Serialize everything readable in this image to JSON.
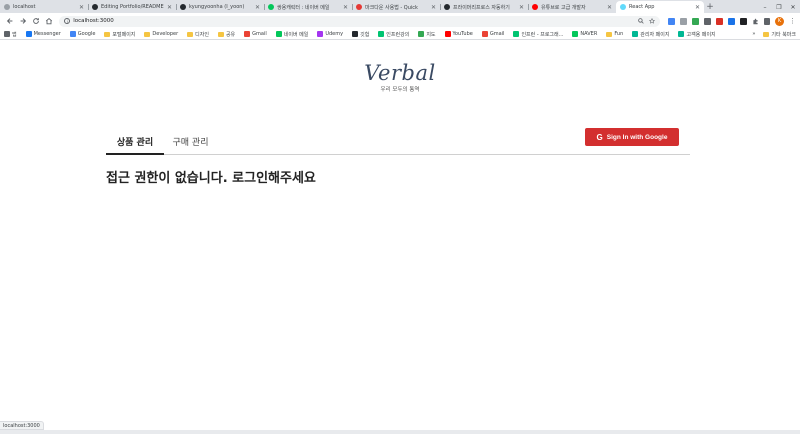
{
  "browser": {
    "tabs": [
      {
        "title": "localhost",
        "icon_color": "#9aa0a6",
        "active": false
      },
      {
        "title": "Editing Portfolio/README",
        "icon_color": "#24292e",
        "active": false
      },
      {
        "title": "kyungyoonha (I_yoon)",
        "icon_color": "#24292e",
        "active": false
      },
      {
        "title": "쌍용캐릭터 : 네이버 메일",
        "icon_color": "#03c75a",
        "active": false
      },
      {
        "title": "마크다운 사용법 - Quick",
        "icon_color": "#e53935",
        "active": false
      },
      {
        "title": "프라이머리프로스 자동하기",
        "icon_color": "#24292e",
        "active": false
      },
      {
        "title": "유튜브로 고급 개발자",
        "icon_color": "#ff0000",
        "active": false
      },
      {
        "title": "React App",
        "icon_color": "#61dafb",
        "active": true
      }
    ],
    "new_tab_label": "+",
    "window_controls": [
      "–",
      "❐",
      "✕"
    ],
    "url": "localhost:3000",
    "bookmarks": [
      {
        "label": "앱",
        "icon": "apps-icon",
        "color": "#5f6368"
      },
      {
        "label": "Messenger",
        "icon": "messenger-icon",
        "color": "#1877f2"
      },
      {
        "label": "Google",
        "icon": "google-icon",
        "color": "#4285f4"
      },
      {
        "label": "포털페이지",
        "icon": "folder-icon",
        "color": "#f5c542"
      },
      {
        "label": "Developer",
        "icon": "folder-icon",
        "color": "#f5c542"
      },
      {
        "label": "디자인",
        "icon": "folder-icon",
        "color": "#f5c542"
      },
      {
        "label": "공유",
        "icon": "folder-icon",
        "color": "#f5c542"
      },
      {
        "label": "Gmail",
        "icon": "gmail-icon",
        "color": "#ea4335"
      },
      {
        "label": "네이버 메일",
        "icon": "naver-icon",
        "color": "#03c75a"
      },
      {
        "label": "Udemy",
        "icon": "udemy-icon",
        "color": "#a435f0"
      },
      {
        "label": "깃헙",
        "icon": "github-icon",
        "color": "#24292e"
      },
      {
        "label": "인프런강의",
        "icon": "inflearn-icon",
        "color": "#00c471"
      },
      {
        "label": "지도",
        "icon": "maps-icon",
        "color": "#34a853"
      },
      {
        "label": "YouTube",
        "icon": "youtube-icon",
        "color": "#ff0000"
      },
      {
        "label": "Gmail",
        "icon": "gmail-icon",
        "color": "#ea4335"
      },
      {
        "label": "인프런 - 프로그래...",
        "icon": "inflearn-icon",
        "color": "#00c471"
      },
      {
        "label": "NAVER",
        "icon": "naver-icon",
        "color": "#03c75a"
      },
      {
        "label": "Fun",
        "icon": "folder-icon",
        "color": "#f5c542"
      },
      {
        "label": "관리자 페이지",
        "icon": "admin-icon",
        "color": "#00b894"
      },
      {
        "label": "고객용 페이지",
        "icon": "customer-icon",
        "color": "#00b894"
      }
    ],
    "bookmarks_overflow": "»",
    "other_bookmarks": "기타 북마크",
    "profile_initial": "K",
    "status_url": "localhost:3000"
  },
  "app": {
    "logo": "Verbal",
    "tagline": "우리 모두의 통역",
    "nav_tabs": [
      {
        "label": "상품 관리",
        "active": true
      },
      {
        "label": "구매 관리",
        "active": false
      }
    ],
    "signin_button": "Sign In with Google",
    "signin_icon": "G",
    "access_message": "접근 권한이 없습니다. 로그인해주세요",
    "colors": {
      "signin_bg": "#d32f2f",
      "logo": "#3a4a63"
    }
  }
}
